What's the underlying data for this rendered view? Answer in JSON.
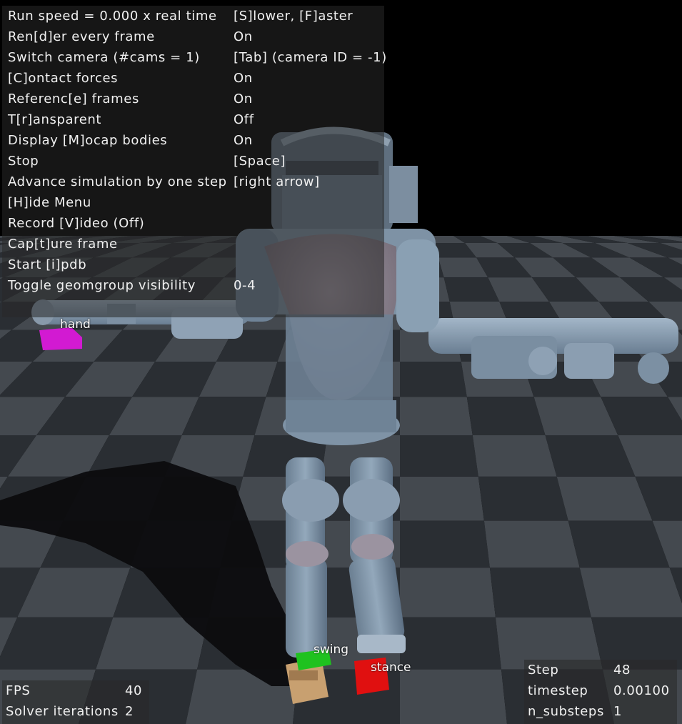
{
  "menu": {
    "items": [
      {
        "key": "Run speed = 0.000 x real time",
        "value": "[S]lower, [F]aster"
      },
      {
        "key": "Ren[d]er every frame",
        "value": "On"
      },
      {
        "key": "Switch camera (#cams = 1)",
        "value": "[Tab] (camera ID = -1)"
      },
      {
        "key": "[C]ontact forces",
        "value": "On"
      },
      {
        "key": "Referenc[e] frames",
        "value": "On"
      },
      {
        "key": "T[r]ansparent",
        "value": "Off"
      },
      {
        "key": "Display [M]ocap bodies",
        "value": "On"
      },
      {
        "key": "Stop",
        "value": "[Space]"
      },
      {
        "key": "Advance simulation by one step",
        "value": "[right arrow]"
      },
      {
        "key": "[H]ide Menu",
        "value": ""
      },
      {
        "key": "Record [V]ideo (Off)",
        "value": ""
      },
      {
        "key": "Cap[t]ure frame",
        "value": ""
      },
      {
        "key": "Start [i]pdb",
        "value": ""
      },
      {
        "key": "Toggle geomgroup visibility",
        "value": "0-4"
      }
    ]
  },
  "stats_left": {
    "rows": [
      {
        "key": "FPS",
        "value": "40"
      },
      {
        "key": "Solver iterations",
        "value": "2"
      }
    ]
  },
  "stats_right": {
    "rows": [
      {
        "key": "Step",
        "value": "48"
      },
      {
        "key": "timestep",
        "value": "0.00100"
      },
      {
        "key": "n_substeps",
        "value": "1"
      }
    ]
  },
  "scene_labels": {
    "hand": "hand",
    "swing": "swing",
    "stance": "stance"
  },
  "colors": {
    "floor_dark": "#2a2e33",
    "floor_light": "#44494f",
    "robot": "#7f93a6",
    "torso": "#8e8590",
    "hand_marker": "#d21ad2",
    "swing_marker": "#1fc21f",
    "stance_marker": "#e01010",
    "foot": "#c8a070"
  }
}
